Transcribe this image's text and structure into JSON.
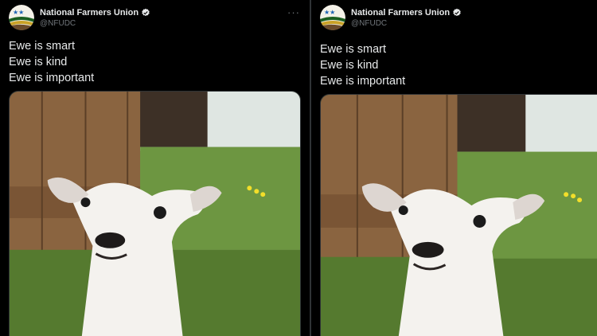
{
  "tweets": [
    {
      "display_name": "National Farmers Union",
      "handle": "@NFUDC",
      "more_label": "···",
      "lines": [
        "Ewe is smart",
        "Ewe is kind",
        "Ewe is important"
      ]
    },
    {
      "display_name": "National Farmers Union",
      "handle": "@NFUDC",
      "lines": [
        "Ewe is smart",
        "Ewe is kind",
        "Ewe is important"
      ]
    }
  ],
  "icons": {
    "avatar": "nfu-logo",
    "verified": "verified-badge-icon",
    "more": "more-options-icon"
  },
  "colors": {
    "background": "#000000",
    "text": "#e7e9ea",
    "secondary": "#71767b",
    "verified": "#e7e9ea"
  }
}
